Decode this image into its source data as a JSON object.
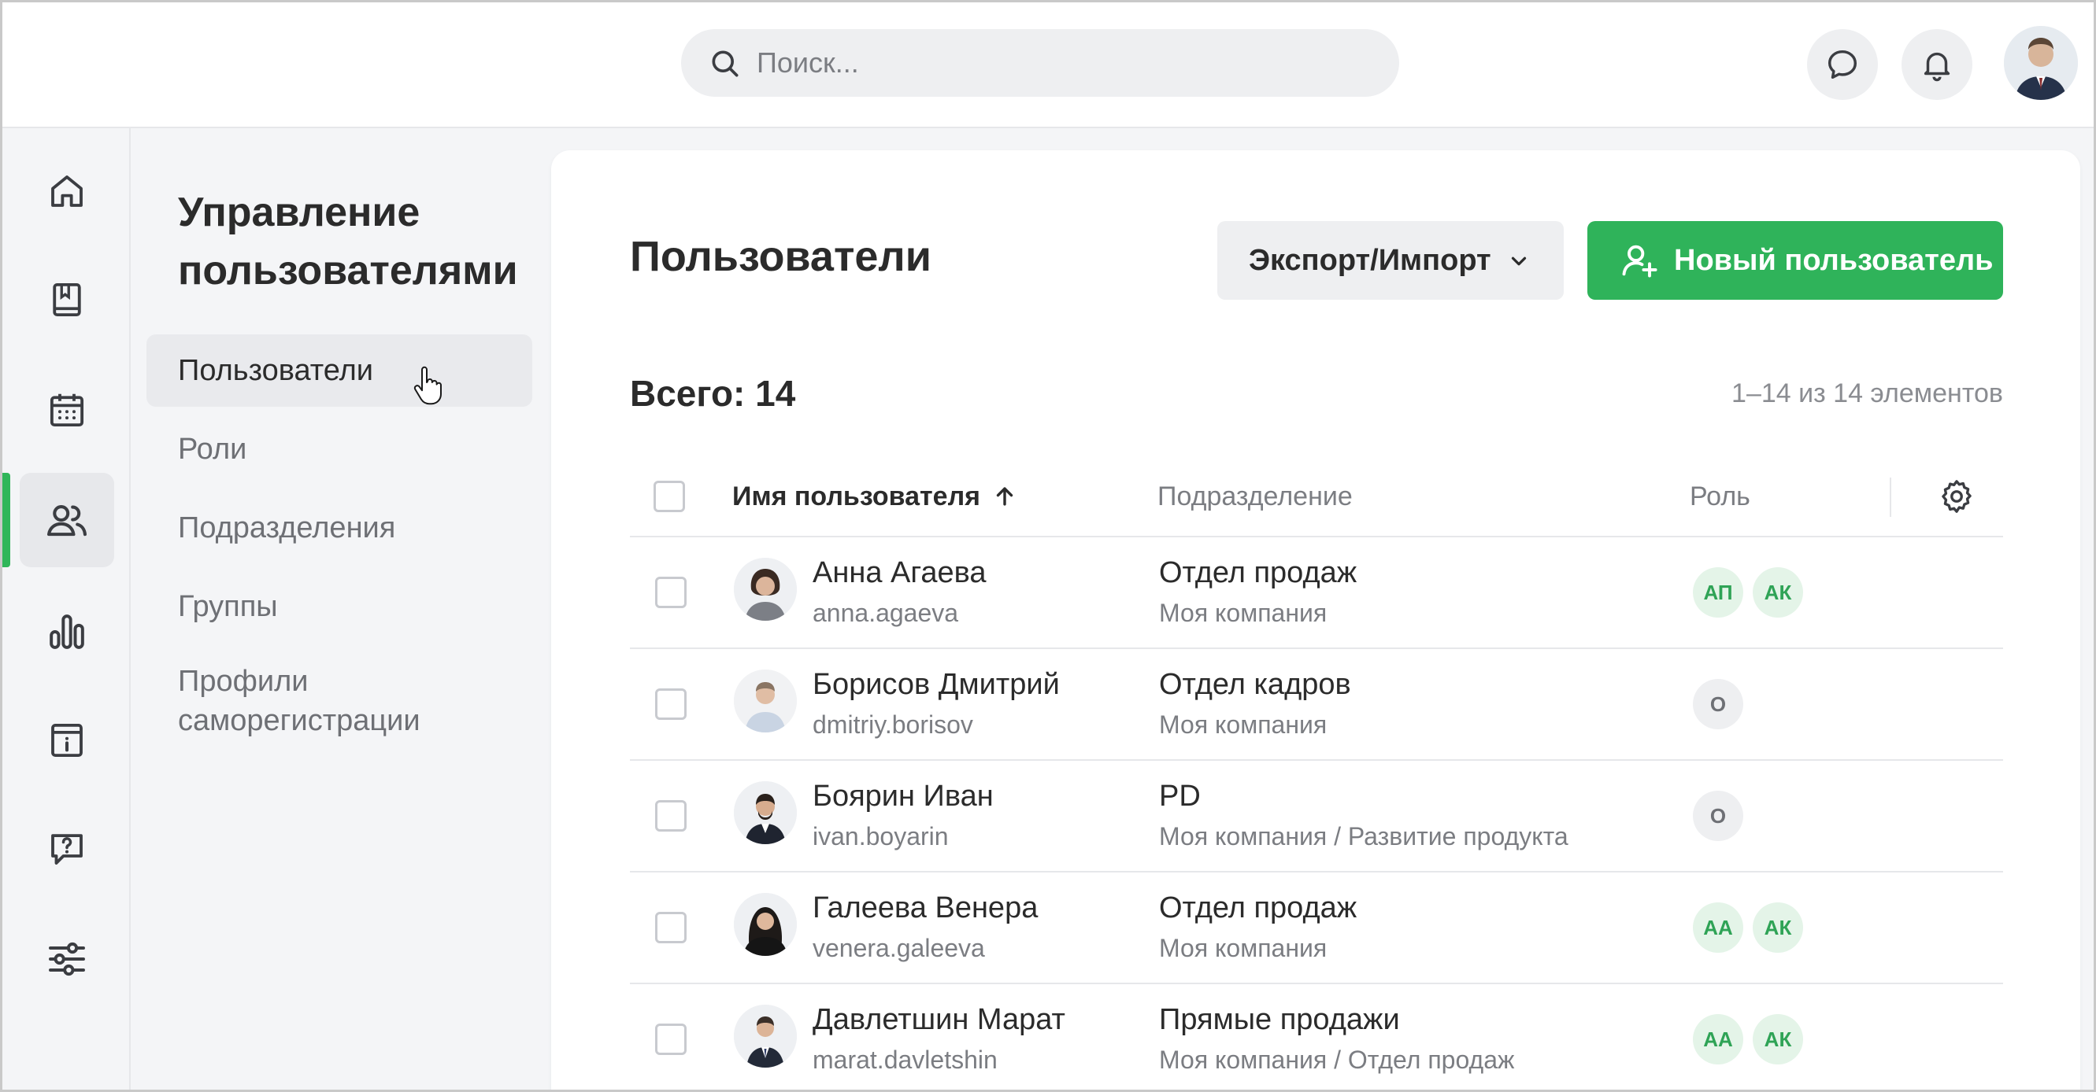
{
  "header": {
    "search_placeholder": "Поиск..."
  },
  "rail": {
    "items": [
      {
        "icon": "home-icon"
      },
      {
        "icon": "book-icon"
      },
      {
        "icon": "calendar-icon"
      },
      {
        "icon": "users-icon",
        "active": true
      },
      {
        "icon": "chart-icon"
      },
      {
        "icon": "info-icon"
      },
      {
        "icon": "help-icon"
      },
      {
        "icon": "settings-sliders-icon"
      }
    ]
  },
  "subnav": {
    "title": "Управление пользователями",
    "items": [
      {
        "label": "Пользователи",
        "active": true
      },
      {
        "label": "Роли"
      },
      {
        "label": "Подразделения"
      },
      {
        "label": "Группы"
      },
      {
        "label": "Профили саморегистрации"
      }
    ]
  },
  "main": {
    "title": "Пользователи",
    "export_label": "Экспорт/Импорт",
    "new_user_label": "Новый пользователь",
    "total_label": "Всего: 14",
    "range_label": "1–14 из 14 элементов",
    "columns": {
      "name": "Имя пользователя",
      "dept": "Подразделение",
      "role": "Роль"
    },
    "rows": [
      {
        "name": "Анна Агаева",
        "login": "anna.agaeva",
        "dept": "Отдел продаж",
        "org": "Моя компания",
        "roles": [
          {
            "t": "АП",
            "c": "green"
          },
          {
            "t": "АК",
            "c": "green"
          }
        ]
      },
      {
        "name": "Борисов Дмитрий",
        "login": "dmitriy.borisov",
        "dept": "Отдел кадров",
        "org": "Моя компания",
        "roles": [
          {
            "t": "О",
            "c": "grey"
          }
        ]
      },
      {
        "name": "Боярин Иван",
        "login": "ivan.boyarin",
        "dept": "PD",
        "org": "Моя компания / Развитие продукта",
        "roles": [
          {
            "t": "О",
            "c": "grey"
          }
        ]
      },
      {
        "name": "Галеева Венера",
        "login": "venera.galeeva",
        "dept": "Отдел продаж",
        "org": "Моя компания",
        "roles": [
          {
            "t": "АА",
            "c": "green"
          },
          {
            "t": "АК",
            "c": "green"
          }
        ]
      },
      {
        "name": "Давлетшин Марат",
        "login": "marat.davletshin",
        "dept": "Прямые продажи",
        "org": "Моя компания / Отдел продаж",
        "roles": [
          {
            "t": "АА",
            "c": "green"
          },
          {
            "t": "АК",
            "c": "green"
          }
        ]
      }
    ]
  },
  "colors": {
    "accent": "#2fb35a",
    "badge_green_bg": "#e4f4e8",
    "badge_green_text": "#2fa356"
  }
}
